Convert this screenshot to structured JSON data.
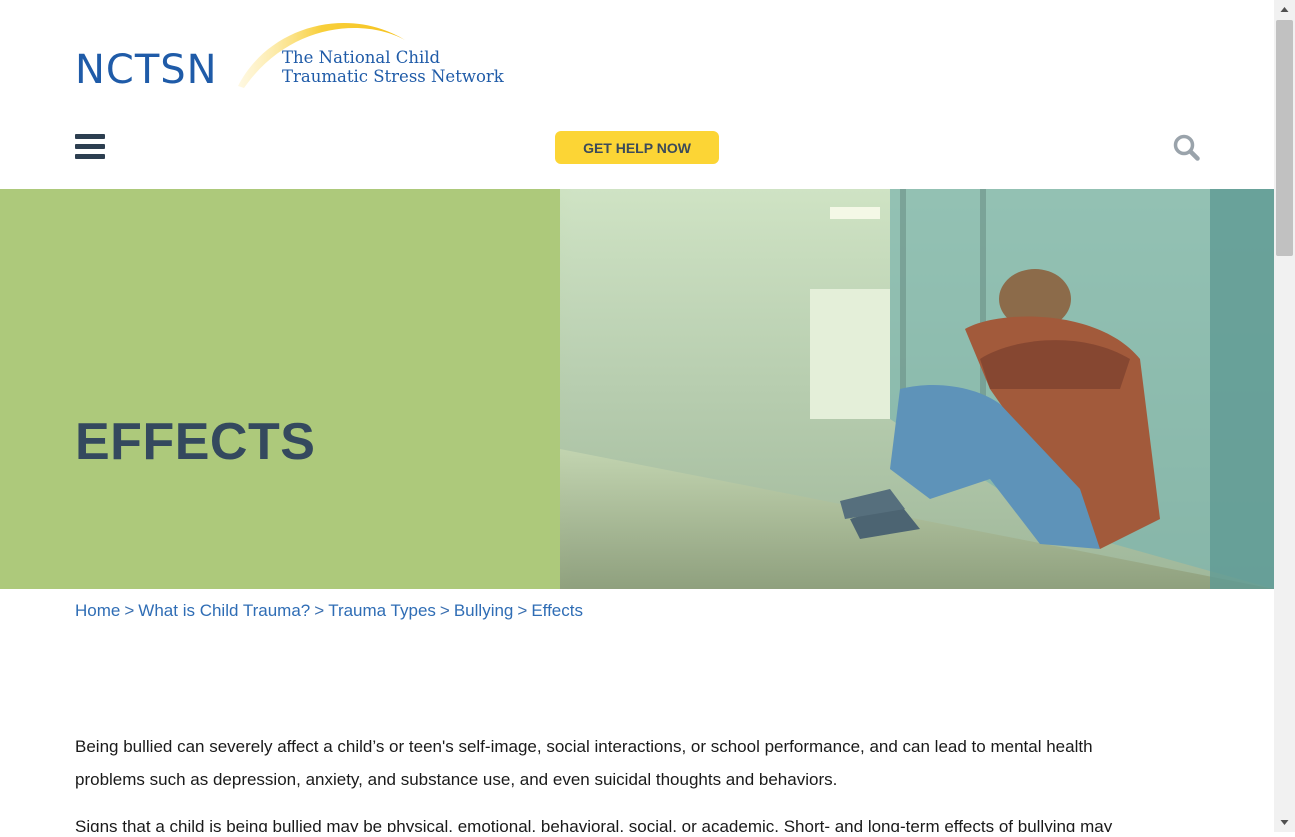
{
  "header": {
    "logo_mark": "NCTSN",
    "logo_name_line1": "The National Child",
    "logo_name_line2": "Traumatic Stress Network",
    "get_help_label": "GET HELP NOW"
  },
  "hero": {
    "title": "EFFECTS"
  },
  "breadcrumb": {
    "items": [
      "Home",
      "What is Child Trauma?",
      "Trauma Types",
      "Bullying",
      "Effects"
    ],
    "separator": ">"
  },
  "content": {
    "paragraphs": [
      "Being bullied can severely affect a child’s or teen's self-image, social interactions, or school performance, and can lead to mental health problems such as depression, anxiety, and substance use, and even suicidal thoughts and behaviors.",
      "Signs that a child is being bullied may be physical, emotional, behavioral, social, or academic. Short- and long-term effects of bullying may"
    ]
  },
  "colors": {
    "brand_blue": "#1f5ba8",
    "hero_green": "#adc97b",
    "help_yellow": "#fcd535",
    "title_slate": "#34495e",
    "link_blue": "#2f6db5"
  },
  "icons": {
    "menu": "hamburger-icon",
    "search": "search-icon",
    "scroll_up": "arrow-up-icon",
    "scroll_down": "arrow-down-icon"
  }
}
